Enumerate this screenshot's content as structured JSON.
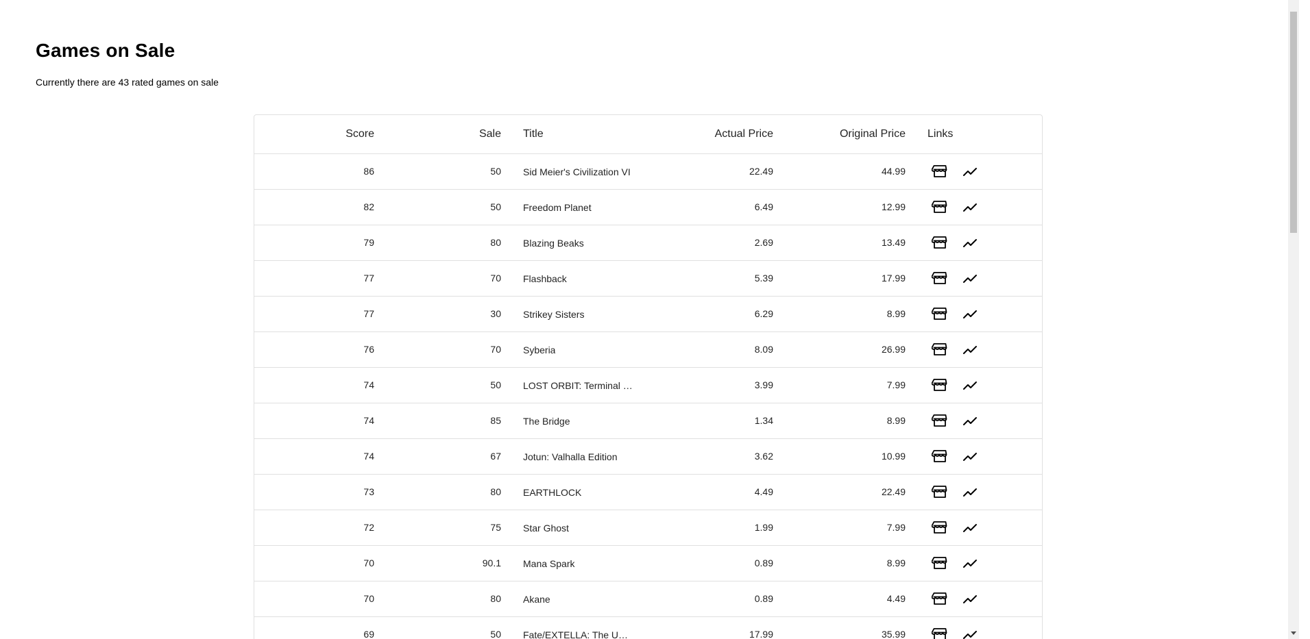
{
  "page": {
    "heading": "Games on Sale",
    "subtitle": "Currently there are 43 rated games on sale"
  },
  "table": {
    "columns": {
      "score": "Score",
      "sale": "Sale",
      "title": "Title",
      "actual_price": "Actual Price",
      "original_price": "Original Price",
      "links": "Links"
    },
    "rows": [
      {
        "score": "86",
        "sale": "50",
        "title": "Sid Meier's Civilization VI",
        "actual_price": "22.49",
        "original_price": "44.99"
      },
      {
        "score": "82",
        "sale": "50",
        "title": "Freedom Planet",
        "actual_price": "6.49",
        "original_price": "12.99"
      },
      {
        "score": "79",
        "sale": "80",
        "title": "Blazing Beaks",
        "actual_price": "2.69",
        "original_price": "13.49"
      },
      {
        "score": "77",
        "sale": "70",
        "title": "Flashback",
        "actual_price": "5.39",
        "original_price": "17.99"
      },
      {
        "score": "77",
        "sale": "30",
        "title": "Strikey Sisters",
        "actual_price": "6.29",
        "original_price": "8.99"
      },
      {
        "score": "76",
        "sale": "70",
        "title": "Syberia",
        "actual_price": "8.09",
        "original_price": "26.99"
      },
      {
        "score": "74",
        "sale": "50",
        "title": "LOST ORBIT: Terminal Velocity",
        "actual_price": "3.99",
        "original_price": "7.99"
      },
      {
        "score": "74",
        "sale": "85",
        "title": "The Bridge",
        "actual_price": "1.34",
        "original_price": "8.99"
      },
      {
        "score": "74",
        "sale": "67",
        "title": "Jotun: Valhalla Edition",
        "actual_price": "3.62",
        "original_price": "10.99"
      },
      {
        "score": "73",
        "sale": "80",
        "title": "EARTHLOCK",
        "actual_price": "4.49",
        "original_price": "22.49"
      },
      {
        "score": "72",
        "sale": "75",
        "title": "Star Ghost",
        "actual_price": "1.99",
        "original_price": "7.99"
      },
      {
        "score": "70",
        "sale": "90.1",
        "title": "Mana Spark",
        "actual_price": "0.89",
        "original_price": "8.99"
      },
      {
        "score": "70",
        "sale": "80",
        "title": "Akane",
        "actual_price": "0.89",
        "original_price": "4.49"
      },
      {
        "score": "69",
        "sale": "50",
        "title": "Fate/EXTELLA: The Umbral Star",
        "actual_price": "17.99",
        "original_price": "35.99"
      }
    ],
    "link_icons": [
      "store-icon",
      "trending-up-icon"
    ]
  }
}
